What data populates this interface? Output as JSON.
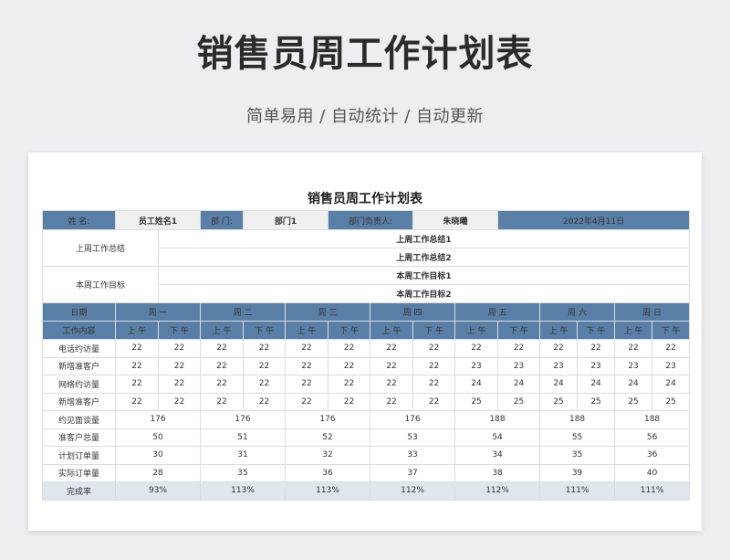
{
  "hero": {
    "title": "销售员周工作计划表",
    "subtitle": "简单易用 / 自动统计 / 自动更新"
  },
  "sheet": {
    "title": "销售员周工作计划表",
    "info": {
      "name_label": "姓 名:",
      "name_value": "员工姓名1",
      "dept_label": "部 门:",
      "dept_value": "部门1",
      "manager_label": "部门负责人:",
      "manager_value": "朱晓曦",
      "date": "2022年4月11日"
    },
    "summary": {
      "last_week_label": "上周工作总结",
      "last_week_items": [
        "上周工作总结1",
        "上周工作总结2"
      ],
      "this_week_label": "本周工作目标",
      "this_week_items": [
        "本周工作目标1",
        "本周工作目标2"
      ]
    },
    "header": {
      "date_label": "日期",
      "content_label": "工作内容",
      "days": [
        "周 一",
        "周 二",
        "周 三",
        "周 四",
        "周 五",
        "周 六",
        "周 日"
      ],
      "am": "上 午",
      "pm": "下 午"
    },
    "half_day_rows": [
      {
        "label": "电话约访量",
        "values": [
          "22",
          "22",
          "22",
          "22",
          "22",
          "22",
          "22",
          "22",
          "22",
          "22",
          "22",
          "22",
          "22",
          "22"
        ]
      },
      {
        "label": "新增准客户",
        "values": [
          "22",
          "22",
          "22",
          "22",
          "22",
          "22",
          "22",
          "22",
          "23",
          "23",
          "23",
          "23",
          "23",
          "23"
        ]
      },
      {
        "label": "网络约访量",
        "values": [
          "22",
          "22",
          "22",
          "22",
          "22",
          "22",
          "22",
          "22",
          "24",
          "24",
          "24",
          "24",
          "24",
          "24"
        ]
      },
      {
        "label": "新增准客户",
        "values": [
          "22",
          "22",
          "22",
          "22",
          "22",
          "22",
          "22",
          "22",
          "25",
          "25",
          "25",
          "25",
          "25",
          "25"
        ]
      }
    ],
    "day_rows": [
      {
        "label": "约见面谈量",
        "values": [
          "176",
          "176",
          "176",
          "176",
          "188",
          "188",
          "188"
        ]
      },
      {
        "label": "准客户总量",
        "values": [
          "50",
          "51",
          "52",
          "53",
          "54",
          "55",
          "56"
        ]
      },
      {
        "label": "计划订单量",
        "values": [
          "30",
          "31",
          "32",
          "33",
          "34",
          "35",
          "36"
        ]
      },
      {
        "label": "实际订单量",
        "values": [
          "28",
          "35",
          "36",
          "37",
          "38",
          "39",
          "40"
        ]
      }
    ],
    "rate_row": {
      "label": "完成率",
      "values": [
        "93%",
        "113%",
        "113%",
        "112%",
        "112%",
        "111%",
        "111%"
      ]
    }
  }
}
